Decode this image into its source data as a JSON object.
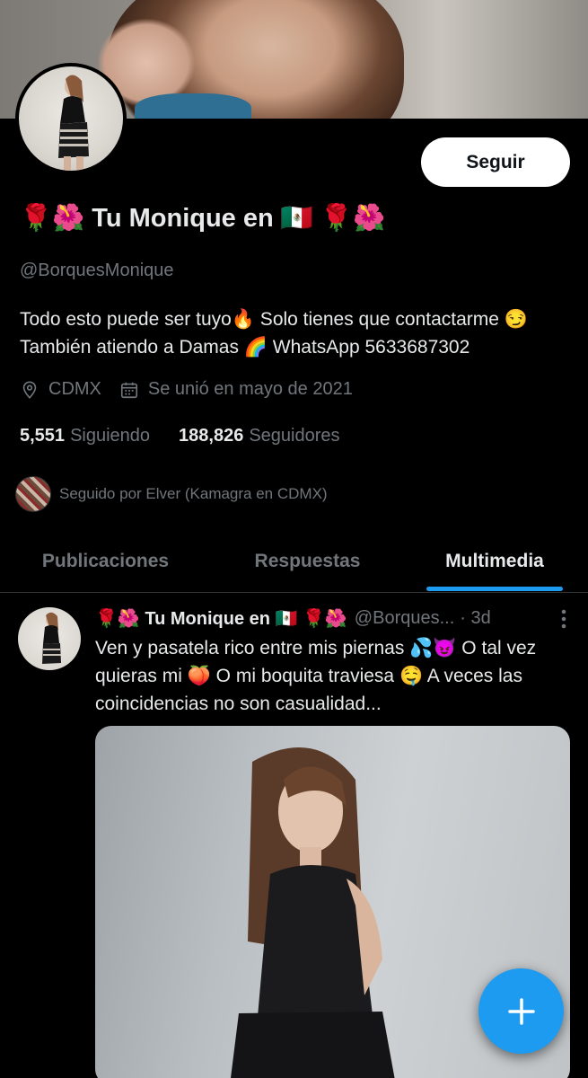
{
  "profile": {
    "display_name": "🌹🌺 Tu Monique en 🇲🇽 🌹🌺",
    "handle": "@BorquesMonique",
    "bio": "Todo esto puede ser tuyo🔥 Solo tienes que contactarme 😏 También atiendo a Damas 🌈 WhatsApp 5633687302",
    "location": "CDMX",
    "joined": "Se unió en mayo de 2021",
    "following_count": "5,551",
    "following_label": "Siguiendo",
    "followers_count": "188,826",
    "followers_label": "Seguidores",
    "followed_by": "Seguido por Elver (Kamagra en CDMX)"
  },
  "actions": {
    "follow_label": "Seguir"
  },
  "tabs": [
    {
      "label": "Publicaciones",
      "active": false
    },
    {
      "label": "Respuestas",
      "active": false
    },
    {
      "label": "Multimedia",
      "active": true
    }
  ],
  "post": {
    "author_name": "🌹🌺 Tu Monique en 🇲🇽 🌹🌺",
    "author_handle": "@Borques...",
    "time": "· 3d",
    "text": "Ven y pasatela rico entre mis piernas 💦😈 O tal vez quieras mi 🍑 O mi boquita traviesa 🤤 A veces las coincidencias no son casualidad..."
  },
  "icons": {
    "location": "location-pin-icon",
    "calendar": "calendar-icon",
    "more": "more-vertical-icon",
    "compose": "plus-icon"
  },
  "colors": {
    "background": "#000000",
    "accent": "#1d9bf0",
    "text_primary": "#e7e9ea",
    "text_secondary": "#71767b"
  }
}
